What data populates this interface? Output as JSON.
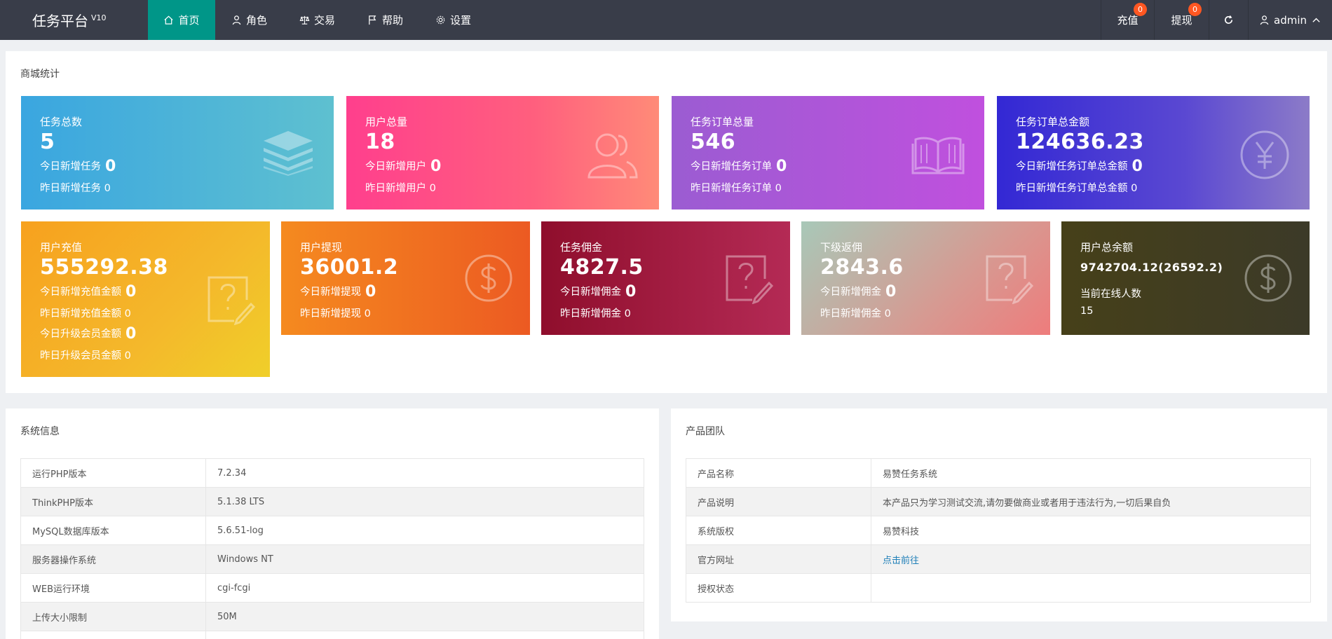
{
  "header": {
    "brand": "任务平台",
    "version": "V10",
    "nav": [
      {
        "label": "首页",
        "icon": "home-icon",
        "active": true
      },
      {
        "label": "角色",
        "icon": "user-icon"
      },
      {
        "label": "交易",
        "icon": "scale-icon"
      },
      {
        "label": "帮助",
        "icon": "flag-icon"
      },
      {
        "label": "设置",
        "icon": "gear-icon"
      }
    ],
    "recharge": {
      "label": "充值",
      "badge": "0"
    },
    "withdraw": {
      "label": "提现",
      "badge": "0"
    },
    "user": {
      "name": "admin"
    }
  },
  "stats": {
    "title": "商城统计",
    "cards": [
      {
        "label": "任务总数",
        "value": "5",
        "lines": [
          {
            "text": "今日新增任务",
            "num": "0"
          },
          {
            "text": "昨日新增任务 0"
          }
        ],
        "icon": "layers-icon"
      },
      {
        "label": "用户总量",
        "value": "18",
        "lines": [
          {
            "text": "今日新增用户",
            "num": "0"
          },
          {
            "text": "昨日新增用户 0"
          }
        ],
        "icon": "users-icon"
      },
      {
        "label": "任务订单总量",
        "value": "546",
        "lines": [
          {
            "text": "今日新增任务订单",
            "num": "0"
          },
          {
            "text": "昨日新增任务订单 0"
          }
        ],
        "icon": "book-icon"
      },
      {
        "label": "任务订单总金额",
        "value": "124636.23",
        "lines": [
          {
            "text": "今日新增任务订单总金额",
            "num": "0"
          },
          {
            "text": "昨日新增任务订单总金额 0"
          }
        ],
        "icon": "yen-icon"
      },
      {
        "label": "用户充值",
        "value": "555292.38",
        "lines": [
          {
            "text": "今日新增充值金额",
            "num": "0"
          },
          {
            "text": "昨日新增充值金额 0"
          },
          {
            "text": "今日升级会员金额",
            "num": "0"
          },
          {
            "text": "昨日升级会员金额 0"
          }
        ],
        "icon": "question-edit-icon"
      },
      {
        "label": "用户提现",
        "value": "36001.2",
        "lines": [
          {
            "text": "今日新增提现",
            "num": "0"
          },
          {
            "text": "昨日新增提现 0"
          }
        ],
        "icon": "dollar-icon"
      },
      {
        "label": "任务佣金",
        "value": "4827.5",
        "lines": [
          {
            "text": "今日新增佣金",
            "num": "0"
          },
          {
            "text": "昨日新增佣金 0"
          }
        ],
        "icon": "question-edit-icon"
      },
      {
        "label": "下级返佣",
        "value": "2843.6",
        "lines": [
          {
            "text": "今日新增佣金",
            "num": "0"
          },
          {
            "text": "昨日新增佣金 0"
          }
        ],
        "icon": "question-edit-icon"
      },
      {
        "label": "用户总余额",
        "value": "9742704.12(26592.2)",
        "lines": [
          {
            "text": "当前在线人数"
          },
          {
            "text": "15"
          }
        ],
        "icon": "dollar-icon"
      }
    ],
    "colors": {
      "accent": "#009688",
      "topbar": "#393d49",
      "badge": "#ff5722"
    }
  },
  "system": {
    "title": "系统信息",
    "rows": [
      [
        "运行PHP版本",
        "7.2.34"
      ],
      [
        "ThinkPHP版本",
        "5.1.38 LTS"
      ],
      [
        "MySQL数据库版本",
        "5.6.51-log"
      ],
      [
        "服务器操作系统",
        "Windows NT"
      ],
      [
        "WEB运行环境",
        "cgi-fcgi"
      ],
      [
        "上传大小限制",
        "50M"
      ],
      [
        "",
        ""
      ]
    ]
  },
  "team": {
    "title": "产品团队",
    "rows": [
      [
        "产品名称",
        "易赞任务系统"
      ],
      [
        "产品说明",
        "本产品只为学习测试交流,请勿要做商业或者用于违法行为,一切后果自负"
      ],
      [
        "系统版权",
        "易赞科技"
      ],
      [
        "官方网址",
        "点击前往"
      ],
      [
        "授权状态",
        ""
      ]
    ]
  }
}
